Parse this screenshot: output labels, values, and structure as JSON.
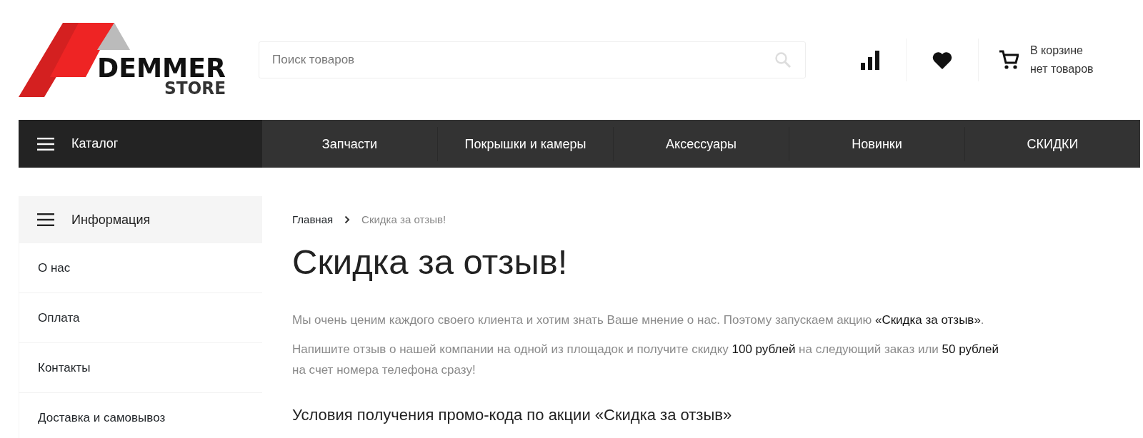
{
  "logo": {
    "line1": "DEMMER",
    "line2": "STORE"
  },
  "search": {
    "placeholder": "Поиск товаров"
  },
  "cart": {
    "line1": "В корзине",
    "line2": "нет товаров"
  },
  "nav": {
    "catalog": "Каталог",
    "items": [
      {
        "label": "Запчасти"
      },
      {
        "label": "Покрышки и камеры"
      },
      {
        "label": "Аксессуары"
      },
      {
        "label": "Новинки"
      },
      {
        "label": "СКИДКИ"
      }
    ]
  },
  "sidebar": {
    "title": "Информация",
    "items": [
      {
        "label": "О нас"
      },
      {
        "label": "Оплата"
      },
      {
        "label": "Контакты"
      },
      {
        "label": "Доставка и самовывоз"
      }
    ]
  },
  "breadcrumb": [
    {
      "label": "Главная",
      "current": false
    },
    {
      "label": "Скидка за отзыв!",
      "current": true
    }
  ],
  "title": "Скидка за отзыв!",
  "paragraphs": [
    "Мы очень ценим каждого своего клиента и хотим знать Ваше мнение о нас. Поэтому запускаем акцию **«Скидка за отзыв»**.",
    "Напишите отзыв о нашей компании на одной из площадок и получите скидку **100 рублей** на следующий заказ или **50 рублей** на счет номера телефона сразу!"
  ],
  "subtitle": "Условия получения промо-кода по акции «Скидка за отзыв»"
}
